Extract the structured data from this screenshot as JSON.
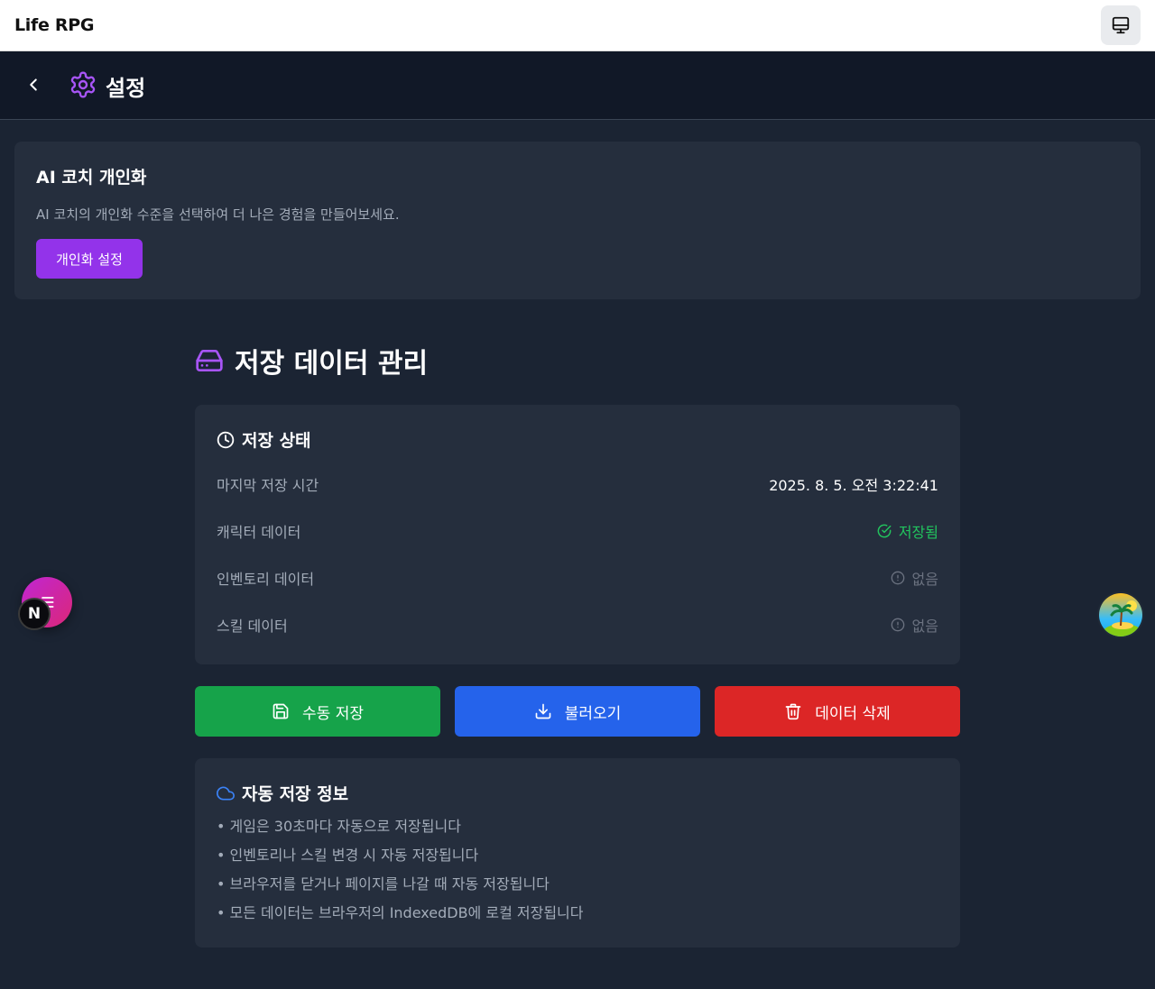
{
  "app": {
    "title": "Life RPG"
  },
  "header": {
    "title": "설정"
  },
  "coach": {
    "title": "AI 코치 개인화",
    "description": "AI 코치의 개인화 수준을 선택하여 더 나은 경험을 만들어보세요.",
    "button_label": "개인화 설정"
  },
  "storage": {
    "title": "저장 데이터 관리",
    "status": {
      "title": "저장 상태",
      "rows": [
        {
          "label": "마지막 저장 시간",
          "value": "2025. 8. 5. 오전 3:22:41",
          "state": "plain"
        },
        {
          "label": "캐릭터 데이터",
          "value": "저장됨",
          "state": "saved",
          "icon": "check-circle-icon"
        },
        {
          "label": "인벤토리 데이터",
          "value": "없음",
          "state": "none",
          "icon": "alert-circle-icon"
        },
        {
          "label": "스킬 데이터",
          "value": "없음",
          "state": "none",
          "icon": "alert-circle-icon"
        }
      ]
    },
    "buttons": {
      "save": "수동 저장",
      "load": "불러오기",
      "delete": "데이터 삭제"
    },
    "auto_info": {
      "title": "자동 저장 정보",
      "items": [
        "• 게임은 30초마다 자동으로 저장됩니다",
        "• 인벤토리나 스킬 변경 시 자동 저장됩니다",
        "• 브라우저를 닫거나 페이지를 나갈 때 자동 저장됩니다",
        "• 모든 데이터는 브라우저의 IndexedDB에 로컬 저장됩니다"
      ]
    }
  },
  "floating": {
    "badge_letter": "N"
  },
  "colors": {
    "accent_purple": "#9333ea",
    "saved_green": "#22c55e",
    "save_button": "#16a34a",
    "load_button": "#2563eb",
    "delete_button": "#dc2626"
  }
}
